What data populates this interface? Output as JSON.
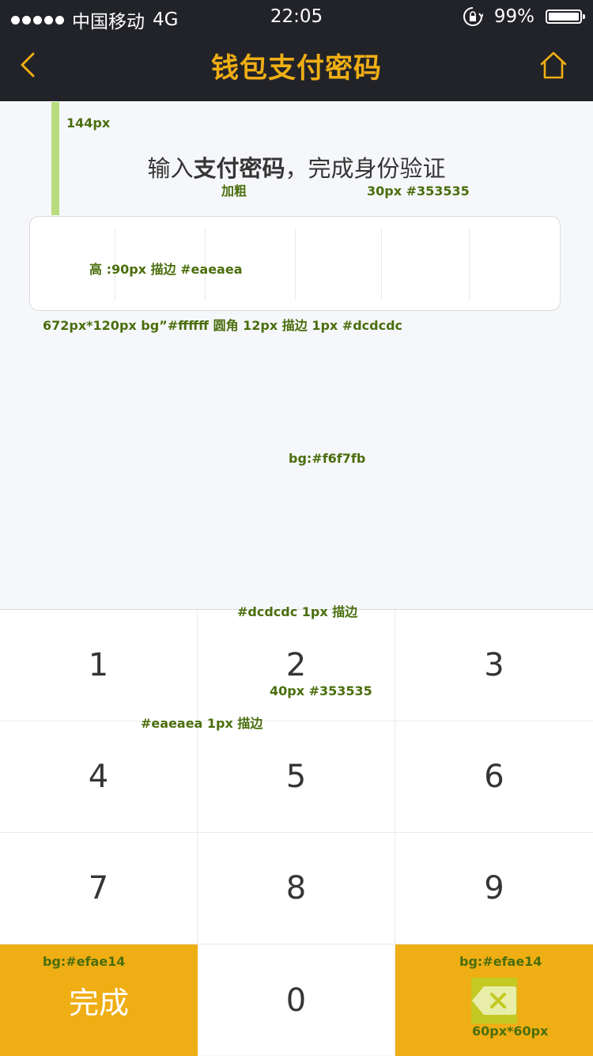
{
  "status_bar": {
    "carrier": "中国移动",
    "network": "4G",
    "time": "22:05",
    "battery": "99%",
    "battery_level": 0.99,
    "signal_icon": "signal-dots-icon",
    "lock_icon": "rotation-lock-icon"
  },
  "nav": {
    "title": "钱包支付密码",
    "back_icon": "chevron-left-icon",
    "home_icon": "home-icon"
  },
  "prompt": {
    "prefix": "输入",
    "bold": "支付密码",
    "suffix": "，完成身份验证"
  },
  "annotations": {
    "a144": "144px",
    "bold_note": "加粗",
    "font_note": "30px  #353535",
    "cell_note": "高 :90px 描边 #eaeaea",
    "box_note": "672px*120px bg”#ffffff  圆角 12px  描边 1px  #dcdcdc",
    "bg_note": "bg:#f6f7fb",
    "keypad_border": "#dcdcdc 1px 描边",
    "key_font": "40px  #353535",
    "key_border": "#eaeaea 1px 描边",
    "done_bg": "bg:#efae14",
    "del_bg": "bg:#efae14",
    "del_size": "60px*60px"
  },
  "keypad": {
    "keys": [
      "1",
      "2",
      "3",
      "4",
      "5",
      "6",
      "7",
      "8",
      "9"
    ],
    "zero": "0",
    "done": "完成",
    "delete_icon": "backspace-icon"
  },
  "colors": {
    "accent": "#efae14",
    "text": "#353535",
    "page_bg": "#f6f7fb",
    "box_border": "#dcdcdc",
    "cell_border": "#eaeaea",
    "nav_bg": "#222328",
    "guide_green": "#b7dc7d"
  }
}
